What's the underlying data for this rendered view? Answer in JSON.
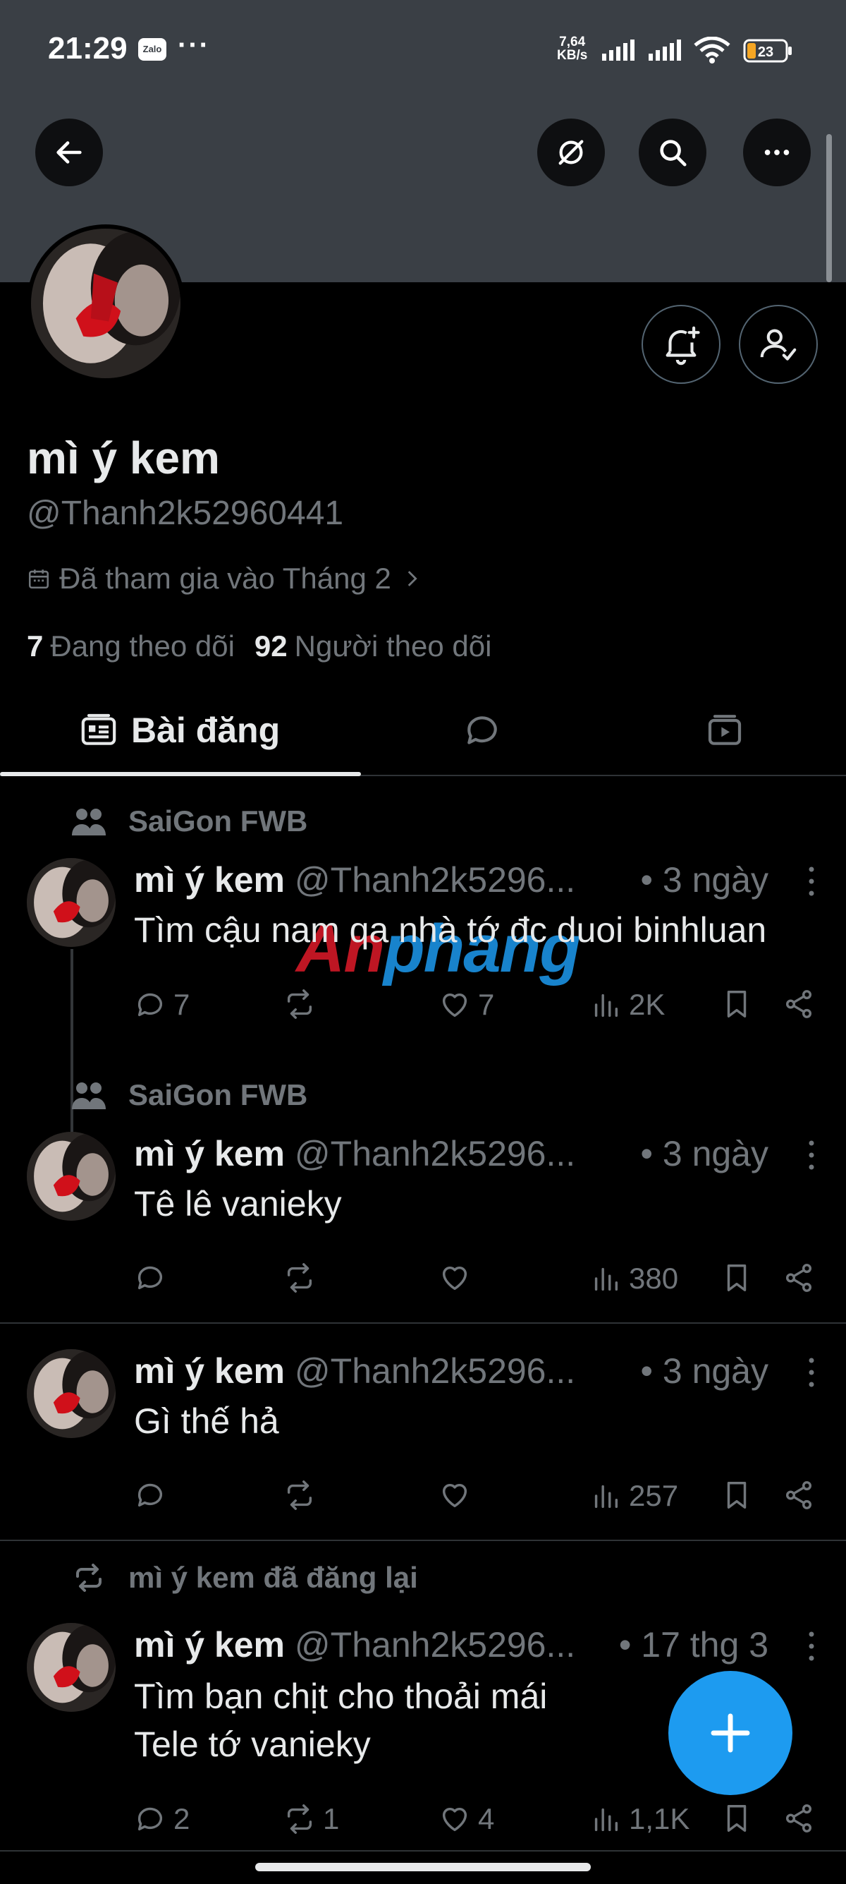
{
  "status_bar": {
    "time": "21:29",
    "zalo_label": "Zalo",
    "more": "···",
    "speed_value": "7,64",
    "speed_unit": "KB/s",
    "battery": "23"
  },
  "header": {
    "back_icon": "arrow-left-icon",
    "grok_icon": "slash-circle-icon",
    "search_icon": "search-icon",
    "more_icon": "more-horizontal-icon"
  },
  "profile": {
    "display_name": "mì ý kem",
    "handle": "@Thanh2k52960441",
    "joined": "Đã tham gia vào Tháng 2",
    "following_count": "7",
    "following_label": "Đang theo dõi",
    "followers_count": "92",
    "followers_label": "Người theo dõi"
  },
  "tabs": {
    "posts_label": "Bài đăng"
  },
  "posts": [
    {
      "context": "SaiGon FWB",
      "name": "mì ý kem",
      "handle": "@Thanh2k5296...",
      "time": "• 3 ngày",
      "text": "Tìm cậu nam qa nhà tớ đc duoi binhluan",
      "replies": "7",
      "reposts": "",
      "likes": "7",
      "views": "2K"
    },
    {
      "context": "SaiGon FWB",
      "name": "mì ý kem",
      "handle": "@Thanh2k5296...",
      "time": "• 3 ngày",
      "text": "Tê lê vanieky",
      "replies": "",
      "reposts": "",
      "likes": "",
      "views": "380"
    },
    {
      "context": "",
      "name": "mì ý kem",
      "handle": "@Thanh2k5296...",
      "time": "• 3 ngày",
      "text": "Gì thế hả",
      "replies": "",
      "reposts": "",
      "likes": "",
      "views": "257"
    },
    {
      "context": "mì ý kem đã đăng lại",
      "name": "mì ý kem",
      "handle": "@Thanh2k5296...",
      "time": "• 17 thg 3",
      "text_line1": "Tìm bạn chịt cho thoải mái",
      "text_line2": "Tele tớ vanieky",
      "replies": "2",
      "reposts": "1",
      "likes": "4",
      "views": "1,1K"
    }
  ],
  "watermark": {
    "part1": "An",
    "part2": "phang"
  },
  "colors": {
    "accent": "#1d9bf0",
    "banner": "#3a3f45",
    "muted_text": "#71767b"
  }
}
